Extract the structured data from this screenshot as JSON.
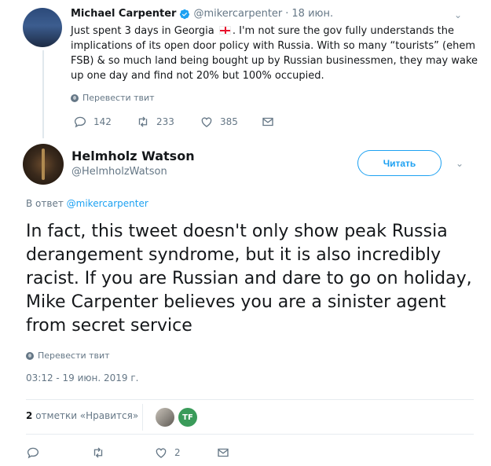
{
  "parent_tweet": {
    "name": "Michael Carpenter",
    "handle": "@mikercarpenter",
    "dot": "·",
    "date": "18 июн.",
    "text_before_flag": "Just spent 3 days in Georgia ",
    "text_after_flag": ". I'm not sure the gov fully understands the implications of its open door policy with Russia. With so many “tourists” (ehem FSB) & so much land being bought up by Russian businessmen, they may wake up one day and find not 20% but 100% occupied.",
    "translate_label": "Перевести твит",
    "replies": "142",
    "retweets": "233",
    "likes": "385"
  },
  "reply_tweet": {
    "name": "Helmholz Watson",
    "handle": "@HelmholzWatson",
    "follow_label": "Читать",
    "reply_prefix": "В ответ",
    "reply_to_handle": "@mikercarpenter",
    "text": "In fact, this tweet doesn't only show peak Russia derangement syndrome, but it is also incredibly racist. If you are Russian and dare to go on holiday, Mike Carpenter believes you are a sinister agent from secret service",
    "translate_label": "Перевести твит",
    "timestamp": "03:12 - 19 июн. 2019 г.",
    "likes_count": "2",
    "likes_label": "отметки «Нравится»",
    "liker_initials": "TF",
    "like_action_count": "2"
  },
  "colors": {
    "accent": "#1da1f2",
    "secondary_text": "#657786",
    "primary_text": "#14171a",
    "divider": "#e6ecf0"
  }
}
